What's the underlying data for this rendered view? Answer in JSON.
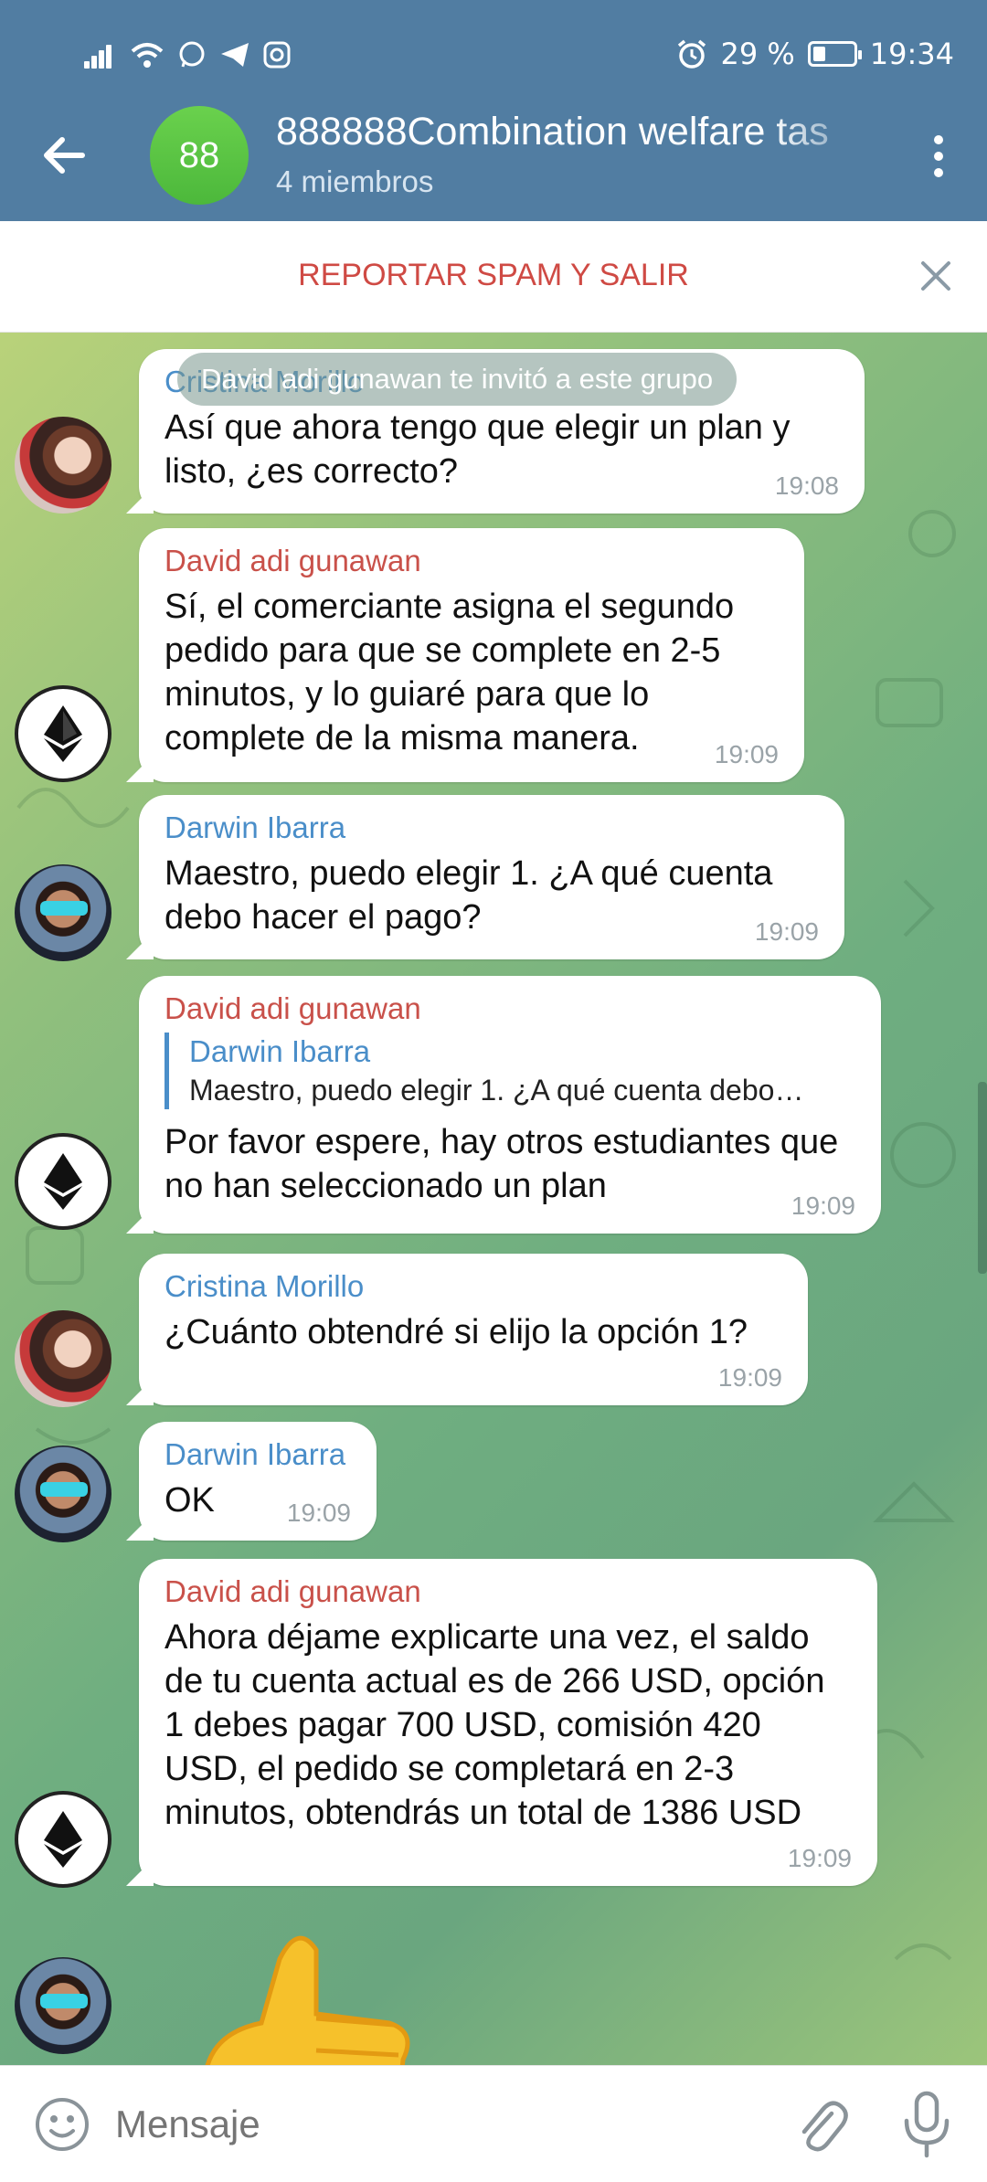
{
  "status_bar": {
    "battery": "29 %",
    "time": "19:34"
  },
  "header": {
    "avatar_text": "88",
    "title": "888888Combination welfare tas",
    "subtitle": "4 miembros"
  },
  "spam_bar": {
    "label": "REPORTAR SPAM Y SALIR"
  },
  "service_message": "David adi gunawan te invitó a este grupo",
  "messages": [
    {
      "sender": "Cristina Morillo",
      "text": "Así que ahora tengo que elegir un plan y listo, ¿es correcto?",
      "time": "19:08"
    },
    {
      "sender": "David adi gunawan",
      "text": "Sí, el comerciante asigna el segundo pedido para que se complete en 2-5 minutos, y lo guiaré para que lo complete de la misma manera.",
      "time": "19:09"
    },
    {
      "sender": "Darwin Ibarra",
      "text": "Maestro, puedo elegir 1. ¿A qué cuenta debo hacer el pago?",
      "time": "19:09"
    },
    {
      "sender": "David adi gunawan",
      "reply_sender": "Darwin Ibarra",
      "reply_text": "Maestro, puedo elegir 1. ¿A qué cuenta debo…",
      "text": "Por favor espere, hay otros estudiantes que no han seleccionado un plan",
      "time": "19:09"
    },
    {
      "sender": "Cristina Morillo",
      "text": "¿Cuánto obtendré si elijo la opción 1?",
      "time": "19:09"
    },
    {
      "sender": "Darwin Ibarra",
      "text": "OK",
      "time": "19:09"
    },
    {
      "sender": "David adi gunawan",
      "text": "Ahora déjame explicarte una vez, el saldo de tu cuenta actual es de 266 USD, opción 1 debes pagar 700 USD, comisión 420 USD, el pedido se completará en 2-3 minutos, obtendrás un total de 1386 USD",
      "time": "19:09"
    }
  ],
  "input": {
    "placeholder": "Mensaje"
  },
  "colors": {
    "header": "#517da2",
    "spam": "#cf4a44",
    "sender_red": "#c9514a",
    "sender_blue": "#4a8ec9"
  }
}
